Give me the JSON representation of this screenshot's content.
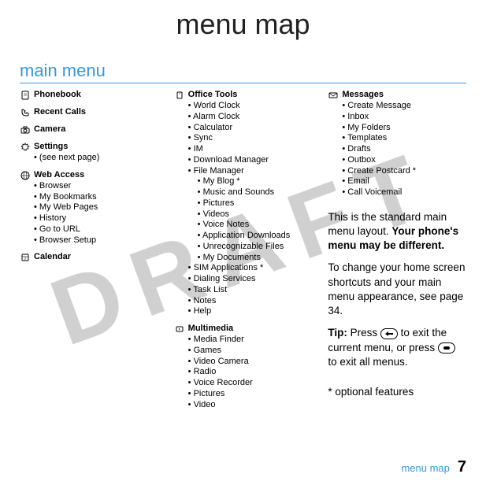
{
  "watermark": "DRAFT",
  "page_title": "menu map",
  "main_menu_heading": "main menu",
  "col1": {
    "phonebook": {
      "label": "Phonebook"
    },
    "recent_calls": {
      "label": "Recent Calls"
    },
    "camera": {
      "label": "Camera"
    },
    "settings": {
      "label": "Settings",
      "items": [
        "(see next page)"
      ]
    },
    "web_access": {
      "label": "Web Access",
      "items": [
        "Browser",
        "My Bookmarks",
        "My Web Pages",
        "History",
        "Go to URL",
        "Browser Setup"
      ]
    },
    "calendar": {
      "label": "Calendar"
    }
  },
  "col2": {
    "office_tools": {
      "label": "Office Tools",
      "items": [
        "World Clock",
        "Alarm Clock",
        "Calculator",
        "Sync",
        "IM",
        "Download Manager"
      ],
      "file_manager": {
        "label": "File Manager",
        "items": [
          "My Blog *",
          "Music and Sounds",
          "Pictures",
          "Videos",
          "Voice Notes",
          "Application Downloads",
          "Unrecognizable Files",
          "My Documents"
        ]
      },
      "items_after": [
        "SIM Applications *",
        "Dialing Services",
        "Task List",
        "Notes",
        "Help"
      ]
    },
    "multimedia": {
      "label": "Multimedia",
      "items": [
        "Media Finder",
        "Games",
        "Video Camera",
        "Radio",
        "Voice Recorder",
        "Pictures",
        "Video"
      ]
    }
  },
  "col3": {
    "messages": {
      "label": "Messages",
      "items": [
        "Create Message",
        "Inbox",
        "My Folders",
        "Templates",
        "Drafts",
        "Outbox",
        "Create Postcard *",
        "Email",
        "Call Voicemail"
      ]
    }
  },
  "description": {
    "p1_a": "This is the standard main menu layout. ",
    "p1_b": "Your phone's menu may be different.",
    "p2": "To change your home screen shortcuts and your main menu appearance, see page 34.",
    "tip_label": "Tip: ",
    "tip_a": "Press ",
    "tip_b": " to exit the current menu, or press ",
    "tip_c": " to exit all menus.",
    "optional": "* optional features"
  },
  "footer": {
    "text": "menu map",
    "page": "7"
  }
}
